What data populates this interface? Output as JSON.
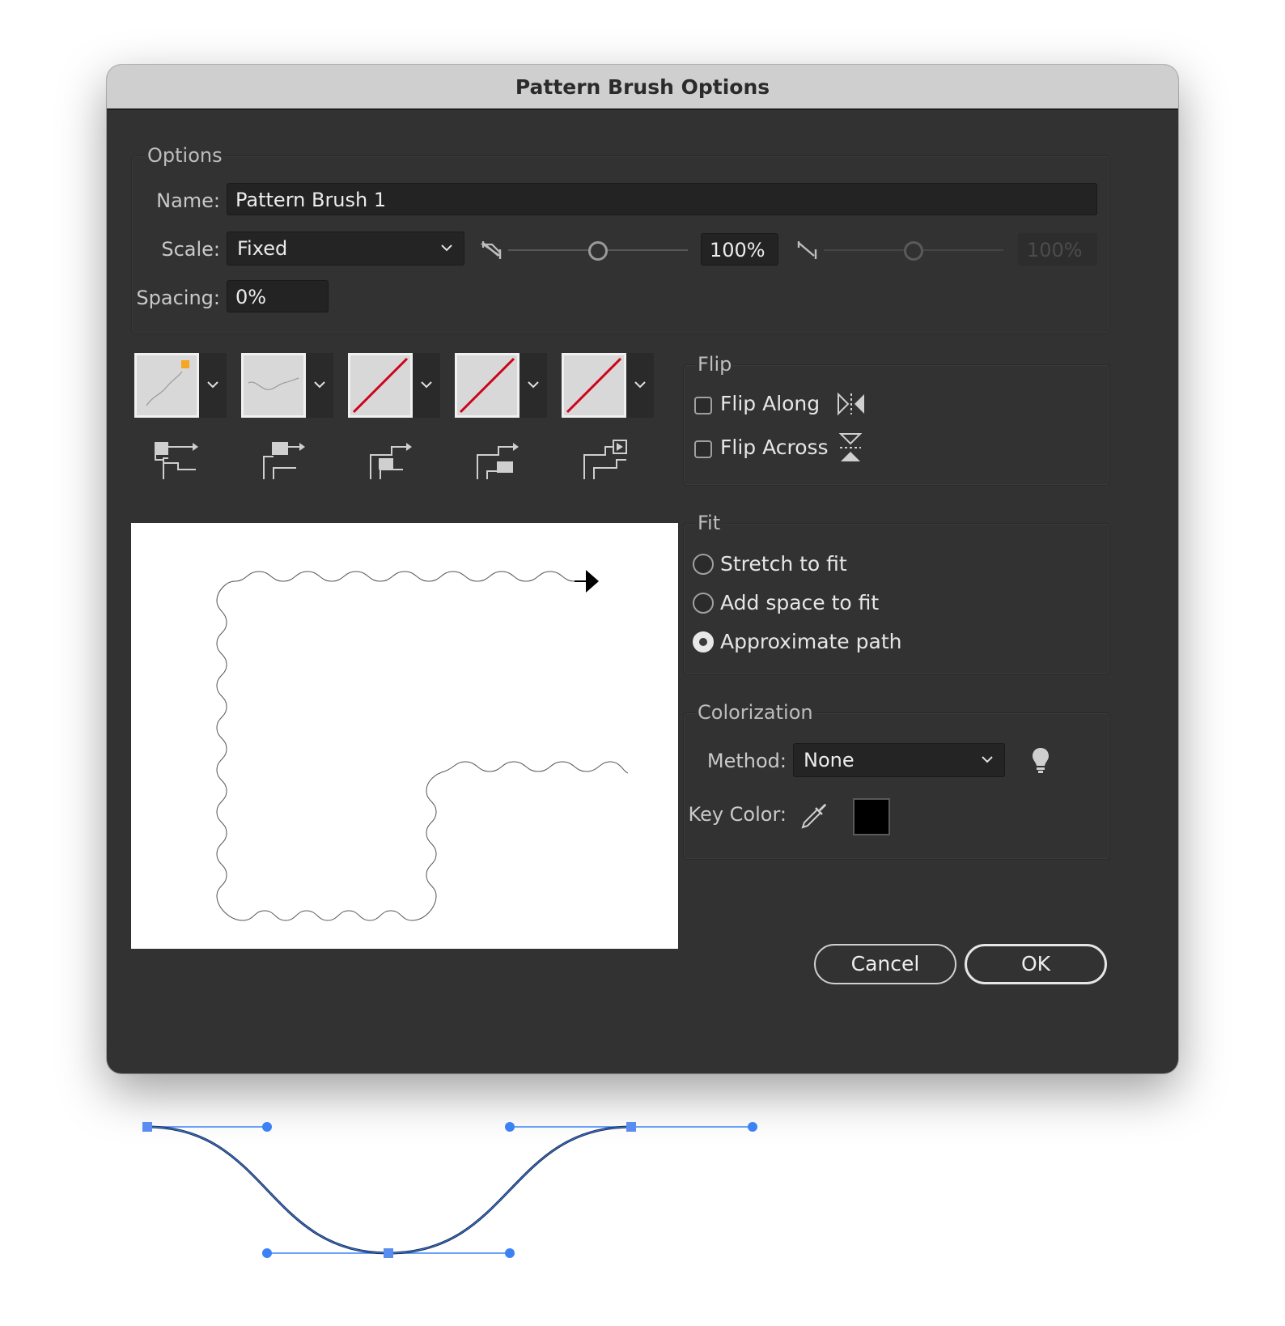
{
  "dialog": {
    "title": "Pattern Brush Options",
    "options": {
      "group_label": "Options",
      "name_label": "Name:",
      "name_value": "Pattern Brush 1",
      "scale_label": "Scale:",
      "scale_value": "Fixed",
      "scale_percent": "100%",
      "scale_percent_2": "100%",
      "spacing_label": "Spacing:",
      "spacing_value": "0%",
      "slider_level": 0.5,
      "slider2_level": 0.5
    },
    "tiles": [
      {
        "name": "side-tile",
        "state": "pattern"
      },
      {
        "name": "outer-corner-tile",
        "state": "pattern"
      },
      {
        "name": "inner-corner-tile",
        "state": "none"
      },
      {
        "name": "start-tile",
        "state": "none"
      },
      {
        "name": "end-tile",
        "state": "none"
      }
    ],
    "flip": {
      "group_label": "Flip",
      "along_label": "Flip Along",
      "across_label": "Flip Across",
      "along_checked": false,
      "across_checked": false
    },
    "fit": {
      "group_label": "Fit",
      "options": [
        "Stretch to fit",
        "Add space to fit",
        "Approximate path"
      ],
      "selected": "Approximate path"
    },
    "colorization": {
      "group_label": "Colorization",
      "method_label": "Method:",
      "method_value": "None",
      "key_color_label": "Key Color:",
      "key_color": "#000000"
    },
    "buttons": {
      "cancel": "Cancel",
      "ok": "OK"
    }
  },
  "colors": {
    "dialog_bg": "#323232",
    "titlebar_bg": "#cfcfcf",
    "none_slash": "#d0021b",
    "corner_marker": "#f5a623",
    "anchor_blue": "#3b82f6",
    "path": "#1a2a4a"
  }
}
